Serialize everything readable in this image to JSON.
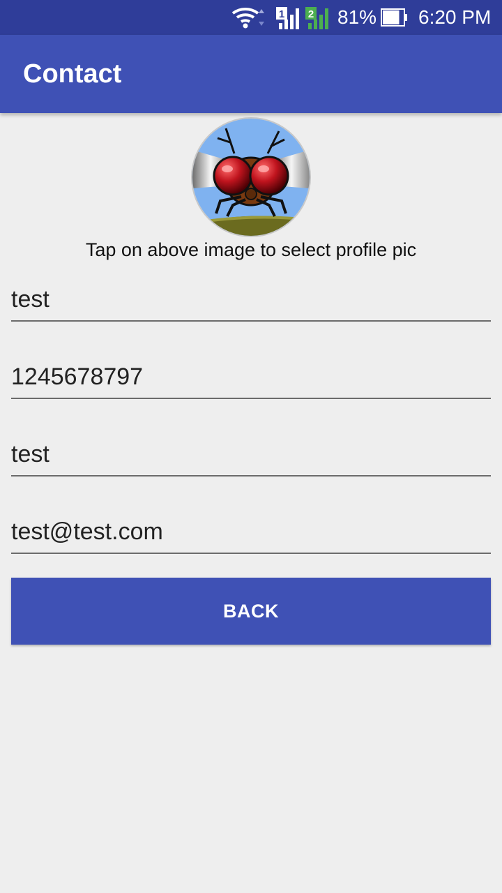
{
  "status_bar": {
    "battery_percent": "81%",
    "battery_level": 0.81,
    "time": "6:20 PM",
    "sim1_label": "1",
    "sim2_label": "2",
    "icons": [
      "wifi-icon",
      "sim1-signal-icon",
      "sim2-signal-icon",
      "battery-icon"
    ],
    "sim2_color": "#4caf50"
  },
  "app_bar": {
    "title": "Contact",
    "color": "#3f51b5"
  },
  "profile": {
    "image": "fly-profile-icon",
    "caption": "Tap on above image to select profile pic"
  },
  "form": {
    "name_value": "test",
    "phone_value": "1245678797",
    "third_value": "test",
    "email_value": "test@test.com"
  },
  "actions": {
    "back_label": "BACK",
    "button_color": "#3f51b5"
  }
}
